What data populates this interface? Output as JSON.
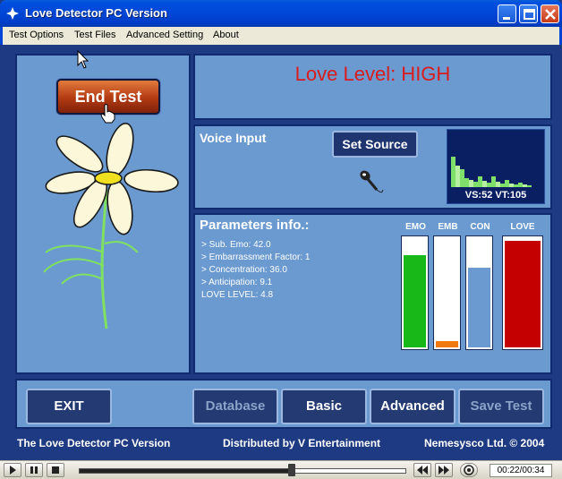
{
  "window": {
    "title": "Love Detector PC Version",
    "icon": "app-logo-icon"
  },
  "menu": [
    "Test Options",
    "Test Files",
    "Advanced Setting",
    "About"
  ],
  "controls": {
    "end_test": "End Test"
  },
  "love_level": "Love Level: HIGH",
  "voice": {
    "label": "Voice Input",
    "set_source": "Set Source",
    "readout": "VS:52 VT:105"
  },
  "params": {
    "title": "Parameters info.:",
    "lines": [
      "> Sub. Emo: 42.0",
      "> Embarrassment Factor: 1",
      "> Concentration: 36.0",
      "> Anticipation: 9.1",
      "LOVE LEVEL: 4.8"
    ]
  },
  "meters": [
    {
      "label": "EMO",
      "level": 0.85,
      "color": "#18b818"
    },
    {
      "label": "EMB",
      "level": 0.09,
      "color": "#f07a10"
    },
    {
      "label": "CON",
      "level": 0.74,
      "color": "#6b9ad0"
    },
    {
      "label": "LOVE",
      "level": 0.98,
      "color": "#c40000"
    }
  ],
  "buttons": {
    "exit": "EXIT",
    "database": "Database",
    "basic": "Basic",
    "advanced": "Advanced",
    "save_test": "Save Test"
  },
  "footer": {
    "left": "The Love Detector PC Version",
    "center": "Distributed by V Entertainment",
    "right": "Nemesysco Ltd. © 2004"
  },
  "media": {
    "timecode": "00:22/00:34",
    "progress": 0.65
  },
  "colors": {
    "panel": "#6b9ad0",
    "background": "#1e3a82",
    "love_text": "#d91c1c"
  }
}
